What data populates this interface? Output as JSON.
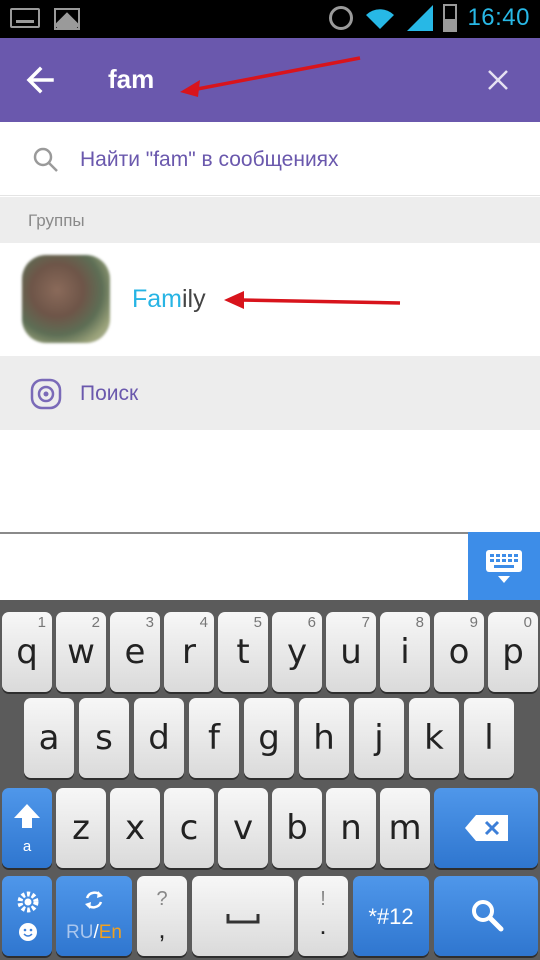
{
  "status_bar": {
    "time": "16:40",
    "icons": [
      "keyboard-icon",
      "image-icon",
      "alarm-icon",
      "wifi-icon",
      "signal-icon",
      "battery-icon"
    ],
    "time_color": "#28b8e6"
  },
  "app_bar": {
    "search_query": "fam",
    "back_icon": "arrow-left-icon",
    "clear_icon": "close-icon",
    "color": "#6a58ad"
  },
  "search_in_messages": {
    "label": "Найти \"fam\" в сообщениях",
    "icon": "search-icon"
  },
  "groups_section": {
    "title": "Группы",
    "results": [
      {
        "name_highlight": "Fam",
        "name_rest": "ily",
        "avatar": "group-avatar"
      }
    ]
  },
  "search_row": {
    "label": "Поиск",
    "icon": "viber-search-icon"
  },
  "keyboard": {
    "row1": [
      {
        "ch": "q",
        "num": "1"
      },
      {
        "ch": "w",
        "num": "2"
      },
      {
        "ch": "e",
        "num": "3"
      },
      {
        "ch": "r",
        "num": "4"
      },
      {
        "ch": "t",
        "num": "5"
      },
      {
        "ch": "y",
        "num": "6"
      },
      {
        "ch": "u",
        "num": "7"
      },
      {
        "ch": "i",
        "num": "8"
      },
      {
        "ch": "o",
        "num": "9"
      },
      {
        "ch": "p",
        "num": "0"
      }
    ],
    "row2": [
      "a",
      "s",
      "d",
      "f",
      "g",
      "h",
      "j",
      "k",
      "l"
    ],
    "row3": [
      "z",
      "x",
      "c",
      "v",
      "b",
      "n",
      "m"
    ],
    "shift_sub": "a",
    "lang_ru": "RU",
    "lang_sep": "/",
    "lang_en": "En",
    "punct_top": "?",
    "punct_bottom": ",",
    "punct2_top": "!",
    "punct2_bottom": ".",
    "symbols_label": "*#12",
    "accent_color": "#3d8de8",
    "lang_active_color": "#f0a020"
  }
}
